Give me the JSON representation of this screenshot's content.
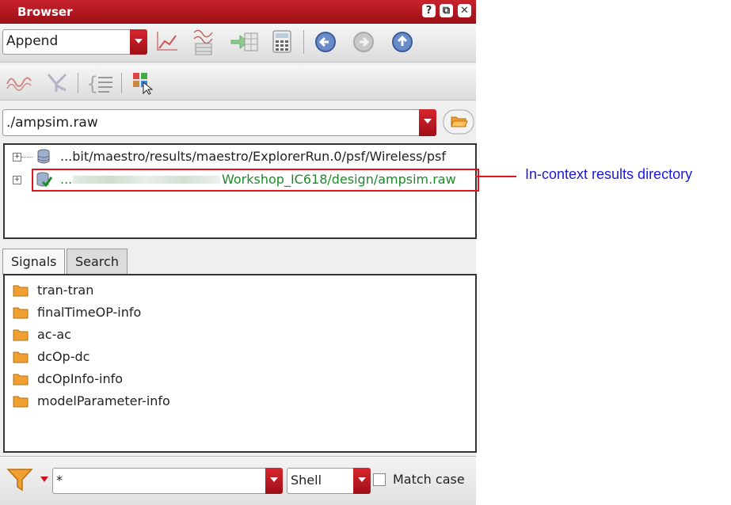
{
  "window": {
    "title": "Browser",
    "buttons": [
      "?",
      "⧉",
      "✕"
    ]
  },
  "toolbar1": {
    "mode_select": {
      "value": "Append"
    }
  },
  "path_select": {
    "value": "./ampsim.raw"
  },
  "tree": {
    "items": [
      {
        "label": "...bit/maestro/results/maestro/ExplorerRun.0/psf/Wireless/psf",
        "icon": "database-icon"
      },
      {
        "label_prefix": "...",
        "label": "Workshop_IC618/design/ampsim.raw",
        "icon": "database-check-icon",
        "color": "#1e8a2a"
      }
    ]
  },
  "tabs": [
    {
      "label": "Signals",
      "active": true
    },
    {
      "label": "Search",
      "active": false
    }
  ],
  "signals": [
    "tran-tran",
    "finalTimeOP-info",
    "ac-ac",
    "dcOp-dc",
    "dcOpInfo-info",
    "modelParameter-info"
  ],
  "filter": {
    "pattern_value": "*",
    "shell_select": "Shell",
    "match_case_label": "Match case",
    "match_case_checked": false
  },
  "annotation": {
    "text": "In-context results directory",
    "color": "#1a1ad8"
  },
  "colors": {
    "title_bar": "#b0141c",
    "accent_red": "#d7262e",
    "highlight": "#e2141e",
    "folder": "#f0a030"
  }
}
